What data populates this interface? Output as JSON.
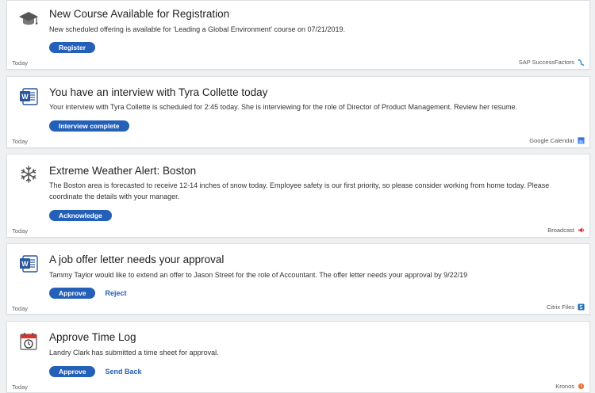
{
  "cards": [
    {
      "title": "New Course Available for Registration",
      "body": "New scheduled offering is available for 'Leading a Global Environment' course on 07/21/2019.",
      "primary": "Register",
      "time": "Today",
      "source": "SAP SuccessFactors",
      "icon": "graduation-cap-icon"
    },
    {
      "title": "You have an interview with Tyra Collette today",
      "body": "Your interview with Tyra Collette is scheduled for 2:45 today. She is interviewing for the role of Director of Product Management. Review her resume.",
      "primary": "Interview complete",
      "time": "Today",
      "source": "Google Calendar",
      "icon": "word-document-icon"
    },
    {
      "title": "Extreme Weather Alert: Boston",
      "body": "The Boston area is forecasted to receive 12-14 inches of snow today. Employee safety is our first priority, so please consider working from home today. Please coordinate the details with your manager.",
      "primary": "Acknowledge",
      "time": "Today",
      "source": "Broadcast",
      "icon": "snowflake-icon"
    },
    {
      "title": "A job offer letter needs your approval",
      "body": "Tammy Taylor would like to extend an offer to Jason Street for the role of Accountant. The offer letter needs your approval by 9/22/19",
      "primary": "Approve",
      "secondary": "Reject",
      "time": "Today",
      "source": "Citrix Files",
      "icon": "word-document-icon"
    },
    {
      "title": "Approve Time Log",
      "body": "Landry Clark has submitted a time sheet for approval.",
      "primary": "Approve",
      "secondary": "Send Back",
      "time": "Today",
      "source": "Kronos",
      "icon": "calendar-clock-icon"
    }
  ],
  "colors": {
    "button": "#2460b8",
    "word_blue": "#2b579a",
    "alert_red": "#d9342b"
  }
}
